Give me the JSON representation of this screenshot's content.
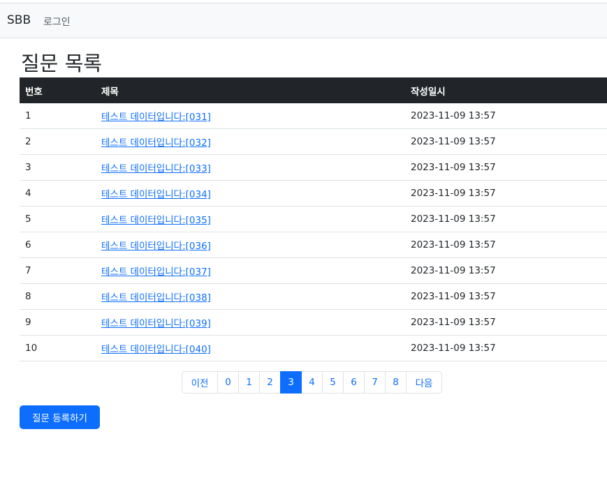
{
  "navbar": {
    "brand": "SBB",
    "login_link": "로그인"
  },
  "main": {
    "title": "질문 목록",
    "table": {
      "headers": [
        "번호",
        "제목",
        "작성일시"
      ],
      "rows": [
        {
          "number": "1",
          "subject": "테스트 데이터입니다:[031]",
          "created": "2023-11-09 13:57"
        },
        {
          "number": "2",
          "subject": "테스트 데이터입니다:[032]",
          "created": "2023-11-09 13:57"
        },
        {
          "number": "3",
          "subject": "테스트 데이터입니다:[033]",
          "created": "2023-11-09 13:57"
        },
        {
          "number": "4",
          "subject": "테스트 데이터입니다:[034]",
          "created": "2023-11-09 13:57"
        },
        {
          "number": "5",
          "subject": "테스트 데이터입니다:[035]",
          "created": "2023-11-09 13:57"
        },
        {
          "number": "6",
          "subject": "테스트 데이터입니다:[036]",
          "created": "2023-11-09 13:57"
        },
        {
          "number": "7",
          "subject": "테스트 데이터입니다:[037]",
          "created": "2023-11-09 13:57"
        },
        {
          "number": "8",
          "subject": "테스트 데이터입니다:[038]",
          "created": "2023-11-09 13:57"
        },
        {
          "number": "9",
          "subject": "테스트 데이터입니다:[039]",
          "created": "2023-11-09 13:57"
        },
        {
          "number": "10",
          "subject": "테스트 데이터입니다:[040]",
          "created": "2023-11-09 13:57"
        }
      ]
    },
    "pagination": {
      "prev_label": "이전",
      "next_label": "다음",
      "pages": [
        "0",
        "1",
        "2",
        "3",
        "4",
        "5",
        "6",
        "7",
        "8"
      ],
      "active_page": "3"
    },
    "create_button": "질문 등록하기"
  },
  "colors": {
    "primary": "#0d6efd",
    "header_bg": "#212529",
    "navbar_bg": "#f8f9fa"
  }
}
